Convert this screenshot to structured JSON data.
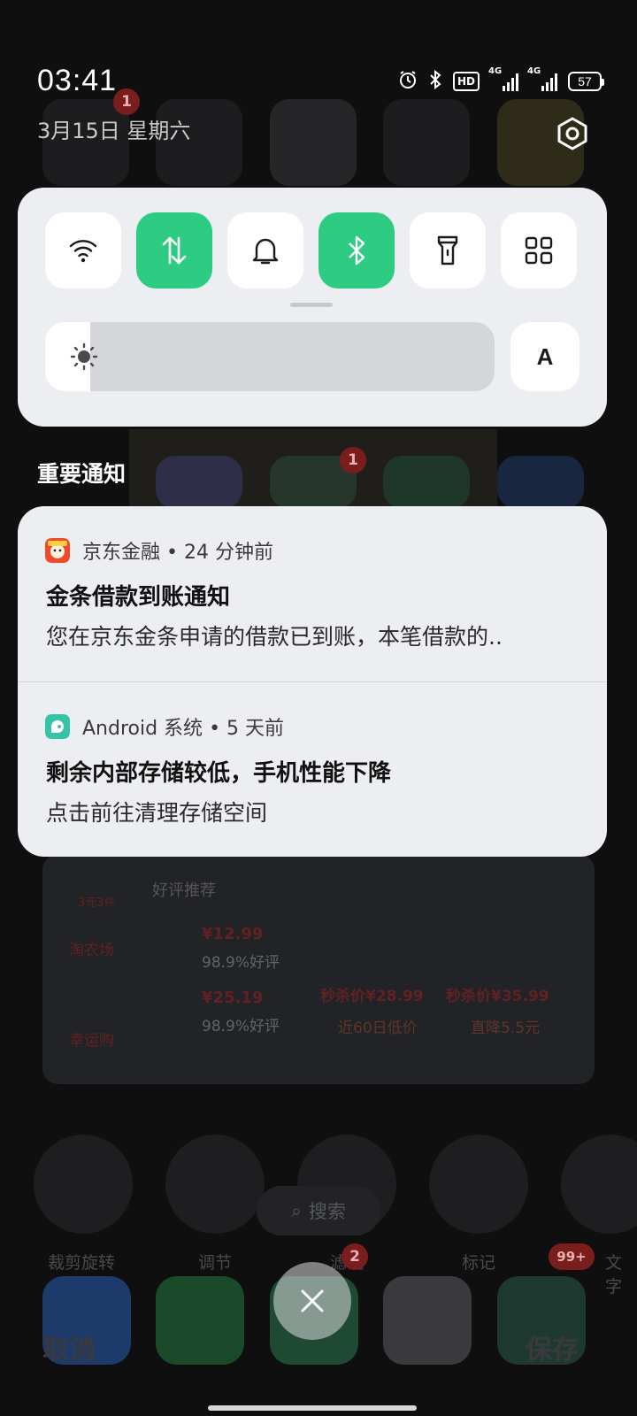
{
  "status_bar": {
    "time": "03:41",
    "date": "3月15日  星期六",
    "hd_label": "HD",
    "network_1": "4G",
    "network_2": "4G",
    "battery": "57",
    "icons": [
      "alarm-icon",
      "bluetooth-icon",
      "hd-icon",
      "signal-icon",
      "signal-icon",
      "battery-icon"
    ]
  },
  "quick_settings": {
    "tiles": [
      {
        "name": "wifi",
        "icon": "wifi-icon",
        "active": false
      },
      {
        "name": "mobile-data",
        "icon": "data-arrows-icon",
        "active": true
      },
      {
        "name": "sound",
        "icon": "bell-icon",
        "active": false
      },
      {
        "name": "bluetooth",
        "icon": "bluetooth-icon",
        "active": true
      },
      {
        "name": "flashlight",
        "icon": "flashlight-icon",
        "active": false
      },
      {
        "name": "more",
        "icon": "grid-icon",
        "active": false
      }
    ],
    "brightness_level": 0.1,
    "auto_label": "A",
    "active_color": "#2ecc82"
  },
  "notifications": {
    "section_title": "重要通知",
    "items": [
      {
        "app": "京东金融",
        "time": "24 分钟前",
        "title": "金条借款到账通知",
        "body": "您在京东金条申请的借款已到账，本笔借款的..",
        "icon": "jd-finance-icon"
      },
      {
        "app": "Android 系统",
        "time": "5 天前",
        "title": "剩余内部存储较低，手机性能下降",
        "body": "点击前往清理存储空间",
        "icon": "android-system-icon"
      }
    ]
  },
  "background": {
    "badges": [
      "1",
      "1",
      "2",
      "99+"
    ],
    "search_label": "搜索",
    "tools": [
      "裁剪旋转",
      "调节",
      "滤镜",
      "标记",
      "文字"
    ],
    "cancel_label": "取消",
    "save_label": "保存",
    "card": {
      "tag_title": "好评推荐",
      "price_1": "¥12.99",
      "rating_1": "98.9%好评",
      "price_2": "¥25.19",
      "rating_2": "98.9%好评",
      "deal_1": "秒杀价¥28.99",
      "deal_2": "秒杀价¥35.99",
      "sub_1": "近60日低价",
      "sub_2": "直降5.5元",
      "side_1": "淘农场",
      "side_2": "幸运购",
      "promo": "3元3件"
    }
  }
}
